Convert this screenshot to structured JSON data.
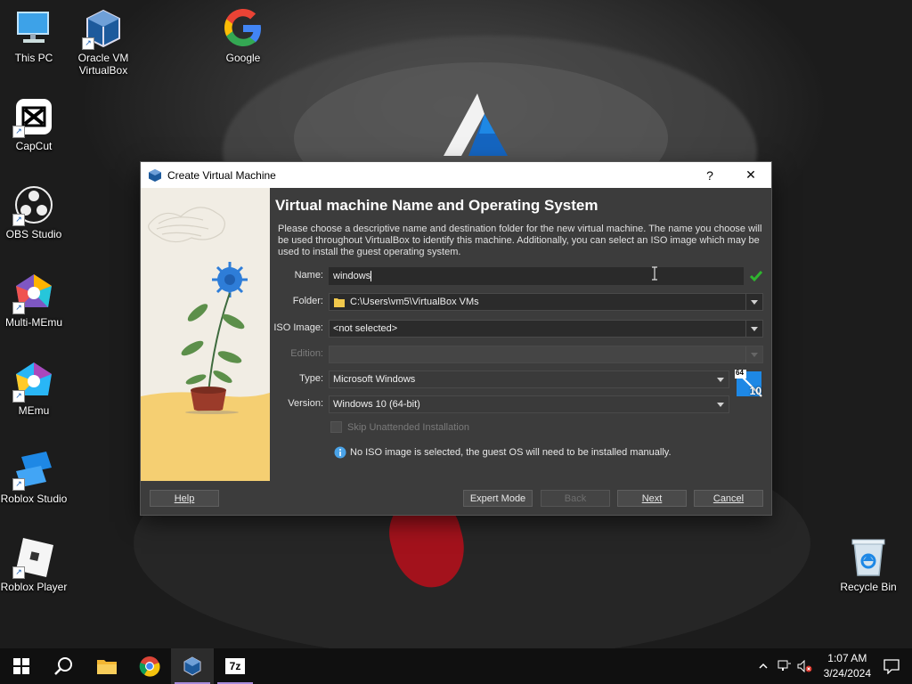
{
  "desktop": {
    "icons": [
      {
        "label": "This PC",
        "icon": "computer-icon"
      },
      {
        "label": "Oracle VM\nVirtualBox",
        "line1": "Oracle VM",
        "line2": "VirtualBox",
        "icon": "virtualbox-icon"
      },
      {
        "label": "Google",
        "icon": "google-icon"
      },
      {
        "label": "CapCut",
        "icon": "capcut-icon"
      },
      {
        "label": "OBS Studio",
        "icon": "obs-icon"
      },
      {
        "label": "Multi-MEmu",
        "icon": "multi-memu-icon"
      },
      {
        "label": "MEmu",
        "icon": "memu-icon"
      },
      {
        "label": "Roblox Studio",
        "icon": "roblox-studio-icon"
      },
      {
        "label": "Roblox Player",
        "icon": "roblox-player-icon"
      },
      {
        "label": "Recycle Bin",
        "icon": "recycle-bin-icon"
      }
    ]
  },
  "dialog": {
    "title": "Create Virtual Machine",
    "help_glyph": "?",
    "close_glyph": "✕",
    "heading": "Virtual machine Name and Operating System",
    "description": "Please choose a descriptive name and destination folder for the new virtual machine. The name you choose will be used throughout VirtualBox to identify this machine. Additionally, you can select an ISO image which may be used to install the guest operating system.",
    "name_label": "Name:",
    "name_value": "windows",
    "folder_label": "Folder:",
    "folder_value": "C:\\Users\\vm5\\VirtualBox VMs",
    "iso_label": "ISO Image:",
    "iso_value": "<not selected>",
    "edition_label": "Edition:",
    "edition_value": "",
    "type_label": "Type:",
    "type_value": "Microsoft Windows",
    "version_label": "Version:",
    "version_value": "Windows 10 (64-bit)",
    "os_badge_top": "64",
    "os_badge_num": "10",
    "skip_unattended_label": "Skip Unattended Installation",
    "skip_unattended_checked": false,
    "info_text": "No ISO image is selected, the guest OS will need to be installed manually.",
    "buttons": {
      "help": "Help",
      "expert": "Expert Mode",
      "back": "Back",
      "next": "Next",
      "cancel": "Cancel"
    }
  },
  "taskbar": {
    "apps": [
      "start-icon",
      "search-icon",
      "file-explorer-icon",
      "chrome-icon",
      "virtualbox-icon",
      "7zip-icon"
    ],
    "sevenzip_label": "7z",
    "time": "1:07 AM",
    "date": "3/24/2024"
  },
  "colors": {
    "accent_check": "#2fb52f",
    "taskbar_active_underline": "#a78bdb"
  }
}
